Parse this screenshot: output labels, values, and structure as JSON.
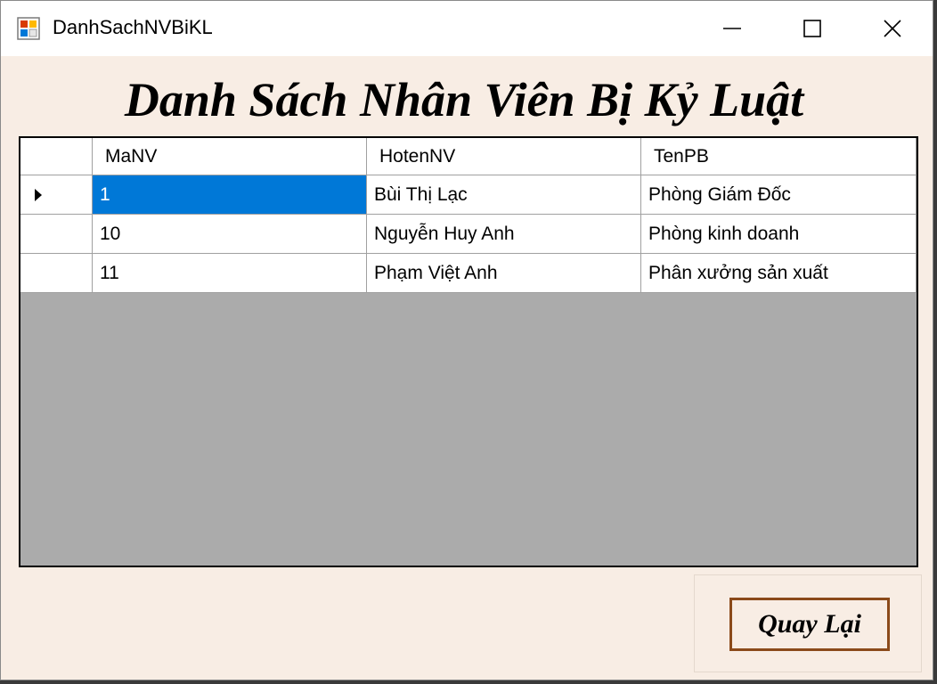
{
  "window": {
    "title": "DanhSachNVBiKL",
    "minimize_icon": "minimize-icon",
    "maximize_icon": "maximize-icon",
    "close_icon": "close-icon"
  },
  "heading": "Danh Sách Nhân Viên Bị Kỷ Luật",
  "grid": {
    "columns": [
      "MaNV",
      "HotenNV",
      "TenPB"
    ],
    "rows": [
      [
        "1",
        "Bùi Thị Lạc",
        "Phòng Giám Đốc"
      ],
      [
        "10",
        "Nguyễn Huy Anh",
        "Phòng kinh doanh"
      ],
      [
        "11",
        "Phạm Việt Anh",
        "Phân xưởng sản xuất"
      ]
    ],
    "selected_row": 0,
    "selection_color": "#0078d7"
  },
  "buttons": {
    "back_label": "Quay Lại"
  },
  "colors": {
    "form_background": "#f8ede4",
    "grid_background": "#ababab",
    "button_border": "#8b4a1a"
  }
}
